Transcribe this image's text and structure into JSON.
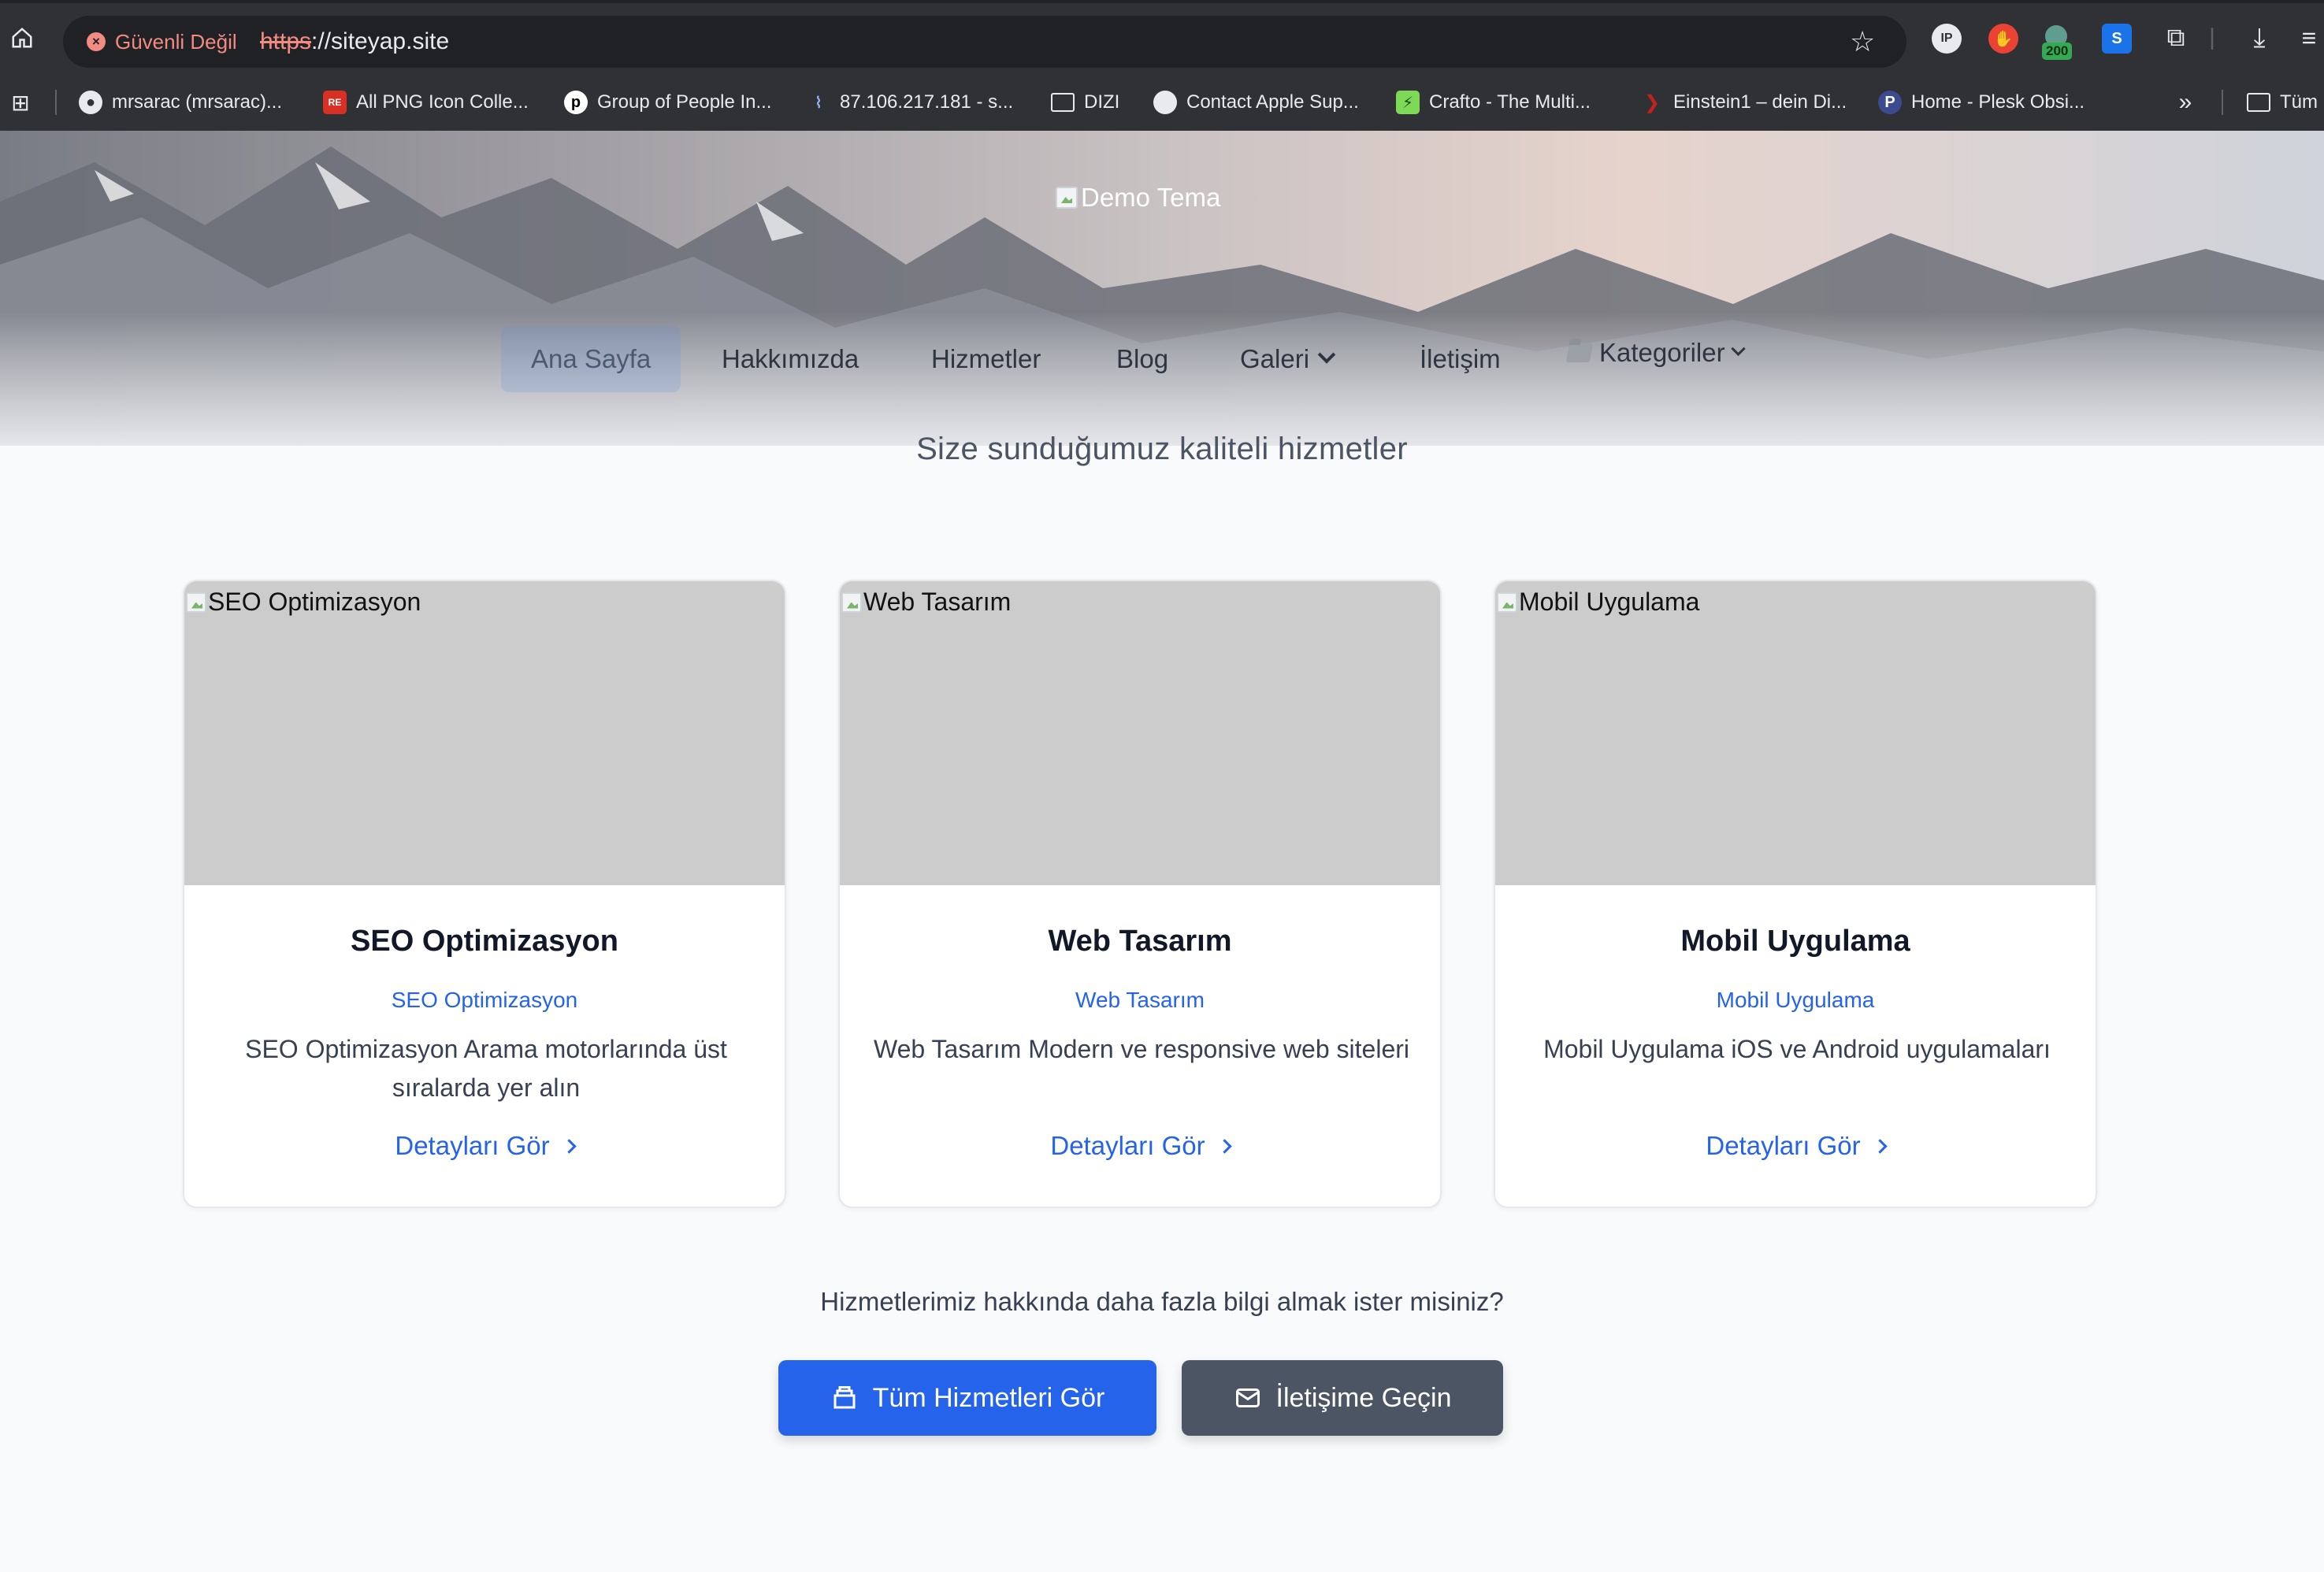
{
  "browser": {
    "security_label": "Güvenli Değil",
    "url_scheme": "https",
    "url_rest": "://siteyap.site",
    "extension_badge": "200",
    "bookmarks": [
      {
        "label": "mrsarac (mrsarac)...",
        "icon": "github-icon"
      },
      {
        "label": "All PNG Icon Colle...",
        "icon": "repo-icon"
      },
      {
        "label": "Group of People In...",
        "icon": "p-logo-icon"
      },
      {
        "label": "87.106.217.181 - s...",
        "icon": "signal-icon"
      },
      {
        "label": "DIZI",
        "icon": "folder-icon"
      },
      {
        "label": "Contact Apple Sup...",
        "icon": "apple-icon"
      },
      {
        "label": "Crafto - The Multi...",
        "icon": "bolt-icon"
      },
      {
        "label": "Einstein1 – dein Di...",
        "icon": "einstein-icon"
      },
      {
        "label": "Home - Plesk Obsi...",
        "icon": "plesk-icon"
      }
    ],
    "all_bookmarks_label": "Tüm"
  },
  "header": {
    "logo_alt": "Demo Tema",
    "nav": [
      {
        "label": "Ana Sayfa"
      },
      {
        "label": "Hakkımızda"
      },
      {
        "label": "Hizmetler"
      },
      {
        "label": "Blog"
      },
      {
        "label": "Galeri"
      },
      {
        "label": "İletişim"
      },
      {
        "label": "Kategoriler"
      }
    ]
  },
  "section": {
    "subtitle": "Size sunduğumuz kaliteli hizmetler"
  },
  "services": [
    {
      "image_alt": "SEO Optimizasyon",
      "title": "SEO Optimizasyon",
      "category": "SEO Optimizasyon",
      "description": "SEO Optimizasyon Arama motorlarında üst sıralarda yer alın",
      "link": "Detayları Gör"
    },
    {
      "image_alt": "Web Tasarım",
      "title": "Web Tasarım",
      "category": "Web Tasarım",
      "description": "Web Tasarım Modern ve responsive web siteleri",
      "link": "Detayları Gör"
    },
    {
      "image_alt": "Mobil Uygulama",
      "title": "Mobil Uygulama",
      "category": "Mobil Uygulama",
      "description": "Mobil Uygulama iOS ve Android uygulamaları",
      "link": "Detayları Gör"
    }
  ],
  "cta": {
    "text": "Hizmetlerimiz hakkında daha fazla bilgi almak ister misiniz?",
    "primary_label": "Tüm Hizmetleri Gör",
    "secondary_label": "İletişime Geçin"
  },
  "colors": {
    "accent": "#2563eb",
    "secondary_button": "#4b5563",
    "card_image_placeholder": "#cccccc"
  }
}
